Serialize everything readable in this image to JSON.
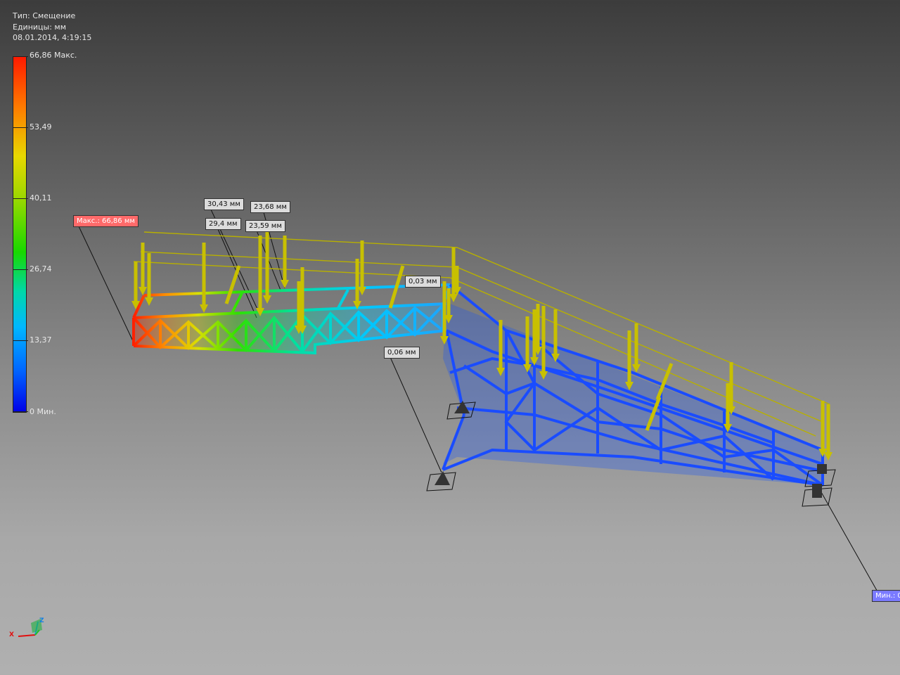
{
  "info": {
    "type_line": "Тип: Смещение",
    "units_line": "Единицы: мм",
    "date_line": "08.01.2014, 4:19:15"
  },
  "legend": {
    "labels": [
      "66,86 Макс.",
      "53,49",
      "40,11",
      "26,74",
      "13,37",
      "0 Мин."
    ]
  },
  "callouts": {
    "max": "Макс.: 66,86 мм",
    "c1": "30,43 мм",
    "c2": "23,68 мм",
    "c3": "29,4 мм",
    "c4": "23,59 мм",
    "c5": "0,03 мм",
    "c6": "0,06 мм",
    "min": "Мин.: 0"
  },
  "axes": {
    "x": "X",
    "z": "Z"
  },
  "colors": {
    "load_arrow": "#c8c000",
    "max_callout": "#ff6a6a",
    "min_callout": "#7a7aff"
  }
}
